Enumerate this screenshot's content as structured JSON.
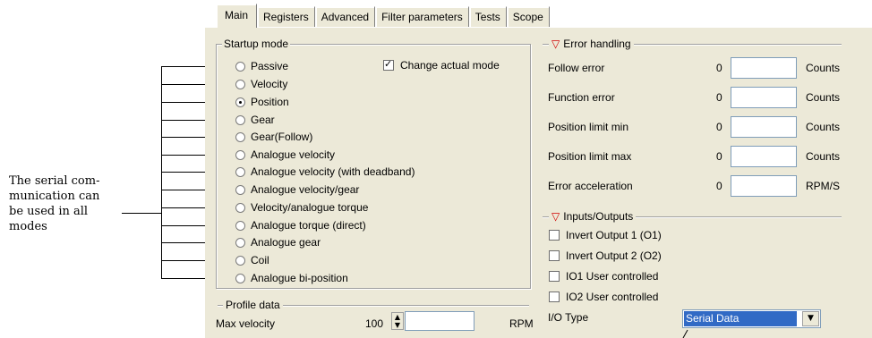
{
  "annotation": {
    "text": "The serial com-\nmunication can\nbe used in all\nmodes"
  },
  "tabs": [
    "Main",
    "Registers",
    "Advanced",
    "Filter parameters",
    "Tests",
    "Scope"
  ],
  "active_tab": "Main",
  "startup_mode": {
    "title": "Startup mode",
    "change_actual_mode": {
      "label": "Change actual mode",
      "checked": true
    },
    "options": [
      {
        "label": "Passive",
        "selected": false
      },
      {
        "label": "Velocity",
        "selected": false
      },
      {
        "label": "Position",
        "selected": true
      },
      {
        "label": "Gear",
        "selected": false
      },
      {
        "label": "Gear(Follow)",
        "selected": false
      },
      {
        "label": "Analogue velocity",
        "selected": false
      },
      {
        "label": "Analogue velocity (with deadband)",
        "selected": false
      },
      {
        "label": "Analogue velocity/gear",
        "selected": false
      },
      {
        "label": "Velocity/analogue torque",
        "selected": false
      },
      {
        "label": "Analogue torque (direct)",
        "selected": false
      },
      {
        "label": "Analogue gear",
        "selected": false
      },
      {
        "label": "Coil",
        "selected": false
      },
      {
        "label": "Analogue bi-position",
        "selected": false
      }
    ]
  },
  "profile_data": {
    "title": "Profile data",
    "max_velocity": {
      "label": "Max velocity",
      "value": "100",
      "unit": "RPM"
    }
  },
  "error_handling": {
    "title": "Error handling",
    "rows": [
      {
        "label": "Follow error",
        "value": "0",
        "unit": "Counts"
      },
      {
        "label": "Function error",
        "value": "0",
        "unit": "Counts"
      },
      {
        "label": "Position limit min",
        "value": "0",
        "unit": "Counts"
      },
      {
        "label": "Position limit max",
        "value": "0",
        "unit": "Counts"
      },
      {
        "label": "Error acceleration",
        "value": "0",
        "unit": "RPM/S"
      }
    ]
  },
  "inputs_outputs": {
    "title": "Inputs/Outputs",
    "checkboxes": [
      {
        "label": "Invert Output 1 (O1)",
        "checked": false
      },
      {
        "label": "Invert Output 2 (O2)",
        "checked": false
      },
      {
        "label": "IO1 User controlled",
        "checked": false
      },
      {
        "label": "IO2 User controlled",
        "checked": false
      }
    ],
    "io_type": {
      "label": "I/O Type",
      "value": "Serial Data"
    }
  }
}
